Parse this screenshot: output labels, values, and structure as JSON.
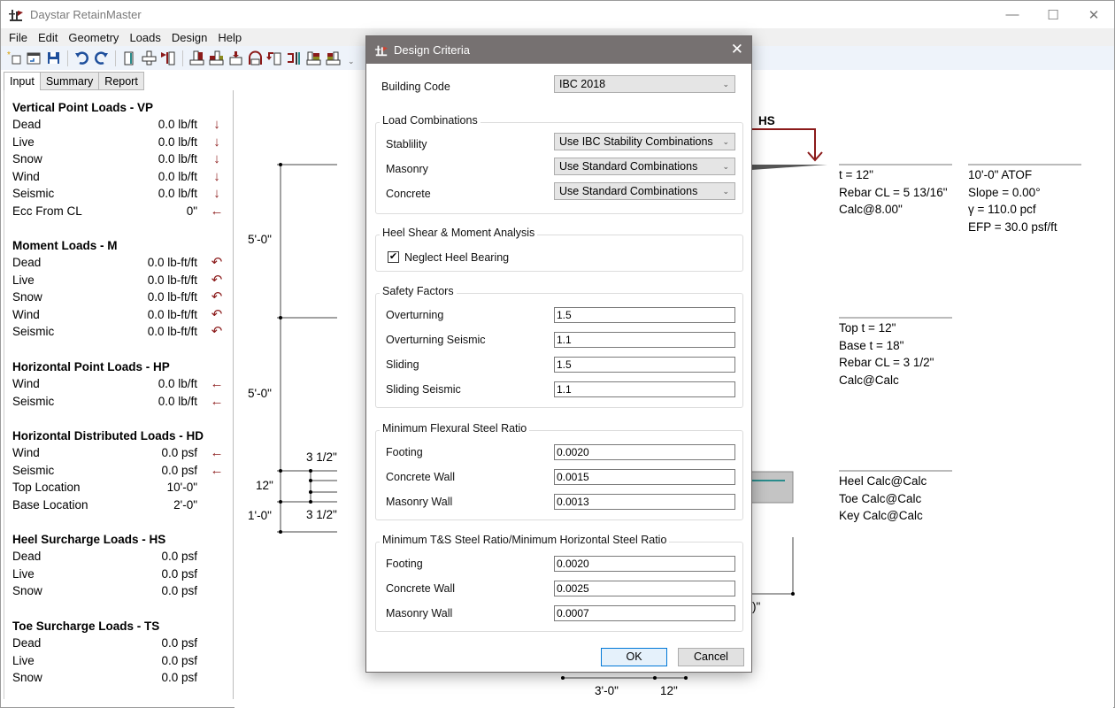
{
  "window": {
    "title": "Daystar RetainMaster",
    "controls": {
      "minimize": "—",
      "maximize": "☐",
      "close": "✕"
    }
  },
  "menu": [
    "File",
    "Edit",
    "Geometry",
    "Loads",
    "Design",
    "Help"
  ],
  "toolbar": {
    "buttons": [
      "new-icon",
      "open-icon",
      "save-icon",
      "undo-icon",
      "redo-icon",
      "wall-icon",
      "footing-icon",
      "wall-load-icon",
      "heel-icon",
      "toe-icon",
      "key-icon",
      "arch-icon",
      "moment-icon",
      "point-load-icon",
      "surcharge-heel-icon",
      "surcharge-toe-icon"
    ],
    "overflow": "⌄"
  },
  "tabs": [
    {
      "label": "Input",
      "active": true
    },
    {
      "label": "Summary",
      "active": false
    },
    {
      "label": "Report",
      "active": false
    }
  ],
  "left_panel": {
    "sections": [
      {
        "title": "Vertical Point Loads - VP",
        "rows": [
          {
            "label": "Dead",
            "value": "0.0 lb/ft",
            "icon": "↓"
          },
          {
            "label": "Live",
            "value": "0.0 lb/ft",
            "icon": "↓"
          },
          {
            "label": "Snow",
            "value": "0.0 lb/ft",
            "icon": "↓"
          },
          {
            "label": "Wind",
            "value": "0.0 lb/ft",
            "icon": "↓"
          },
          {
            "label": "Seismic",
            "value": "0.0 lb/ft",
            "icon": "↓"
          },
          {
            "label": "Ecc From CL",
            "value": "0\"",
            "icon": "←"
          }
        ]
      },
      {
        "title": "Moment Loads - M",
        "rows": [
          {
            "label": "Dead",
            "value": "0.0 lb-ft/ft",
            "icon": "↶"
          },
          {
            "label": "Live",
            "value": "0.0 lb-ft/ft",
            "icon": "↶"
          },
          {
            "label": "Snow",
            "value": "0.0 lb-ft/ft",
            "icon": "↶"
          },
          {
            "label": "Wind",
            "value": "0.0 lb-ft/ft",
            "icon": "↶"
          },
          {
            "label": "Seismic",
            "value": "0.0 lb-ft/ft",
            "icon": "↶"
          }
        ]
      },
      {
        "title": "Horizontal Point Loads - HP",
        "rows": [
          {
            "label": "Wind",
            "value": "0.0 lb/ft",
            "icon": "←"
          },
          {
            "label": "Seismic",
            "value": "0.0 lb/ft",
            "icon": "←"
          }
        ]
      },
      {
        "title": "Horizontal Distributed Loads - HD",
        "rows": [
          {
            "label": "Wind",
            "value": "0.0 psf",
            "icon": "←"
          },
          {
            "label": "Seismic",
            "value": "0.0 psf",
            "icon": "←"
          },
          {
            "label": "Top Location",
            "value": "10'-0\"",
            "icon": ""
          },
          {
            "label": "Base Location",
            "value": "2'-0\"",
            "icon": ""
          }
        ]
      },
      {
        "title": "Heel Surcharge Loads - HS",
        "rows": [
          {
            "label": "Dead",
            "value": "0.0 psf",
            "icon": ""
          },
          {
            "label": "Live",
            "value": "0.0 psf",
            "icon": ""
          },
          {
            "label": "Snow",
            "value": "0.0 psf",
            "icon": ""
          }
        ]
      },
      {
        "title": "Toe Surcharge Loads - TS",
        "rows": [
          {
            "label": "Dead",
            "value": "0.0 psf",
            "icon": ""
          },
          {
            "label": "Live",
            "value": "0.0 psf",
            "icon": ""
          },
          {
            "label": "Snow",
            "value": "0.0 psf",
            "icon": ""
          }
        ]
      }
    ]
  },
  "drawing": {
    "dims_left": [
      "5'-0\"",
      "5'-0\"",
      "12\"",
      "1'-0\"",
      "3 1/2\"",
      "3 1/2\""
    ],
    "dims_bottom": [
      "3'-0\"",
      "12\""
    ],
    "partial_dim": ")\"",
    "hs_label": "HS",
    "wall_top_info": [
      "t = 12\"",
      "Rebar CL = 5 13/16\"",
      "Calc@8.00\""
    ],
    "soil_info": [
      "10'-0\" ATOF",
      "Slope = 0.00°",
      "γ = 110.0 pcf",
      "EFP = 30.0 psf/ft"
    ],
    "wall_base_info": [
      "Top t = 12\"",
      "Base t = 18\"",
      "Rebar CL = 3 1/2\"",
      "Calc@Calc"
    ],
    "footing_info": [
      "Heel Calc@Calc",
      "Toe Calc@Calc",
      "Key Calc@Calc"
    ],
    "colors": {
      "load": "#8b1a1a",
      "rebar": "#2a8c8c"
    }
  },
  "dialog": {
    "title": "Design Criteria",
    "close": "✕",
    "building_code": {
      "label": "Building Code",
      "value": "IBC 2018"
    },
    "load_combinations": {
      "title": "Load Combinations",
      "items": [
        {
          "label": "Stablility",
          "value": "Use IBC Stability Combinations"
        },
        {
          "label": "Masonry",
          "value": "Use Standard Combinations"
        },
        {
          "label": "Concrete",
          "value": "Use Standard Combinations"
        }
      ]
    },
    "heel_analysis": {
      "title": "Heel Shear & Moment Analysis",
      "checkbox_label": "Neglect Heel Bearing",
      "checked": true,
      "check_glyph": "✔"
    },
    "safety_factors": {
      "title": "Safety Factors",
      "items": [
        {
          "label": "Overturning",
          "value": "1.5"
        },
        {
          "label": "Overturning Seismic",
          "value": "1.1"
        },
        {
          "label": "Sliding",
          "value": "1.5"
        },
        {
          "label": "Sliding Seismic",
          "value": "1.1"
        }
      ]
    },
    "min_flexural": {
      "title": "Minimum Flexural Steel Ratio",
      "items": [
        {
          "label": "Footing",
          "value": "0.0020"
        },
        {
          "label": "Concrete Wall",
          "value": "0.0015"
        },
        {
          "label": "Masonry Wall",
          "value": "0.0013"
        }
      ]
    },
    "min_ts": {
      "title": "Minimum T&S Steel Ratio/Minimum Horizontal Steel Ratio",
      "items": [
        {
          "label": "Footing",
          "value": "0.0020"
        },
        {
          "label": "Concrete Wall",
          "value": "0.0025"
        },
        {
          "label": "Masonry Wall",
          "value": "0.0007"
        }
      ]
    },
    "ok_label": "OK",
    "cancel_label": "Cancel",
    "combo_chevron": "⌄"
  }
}
